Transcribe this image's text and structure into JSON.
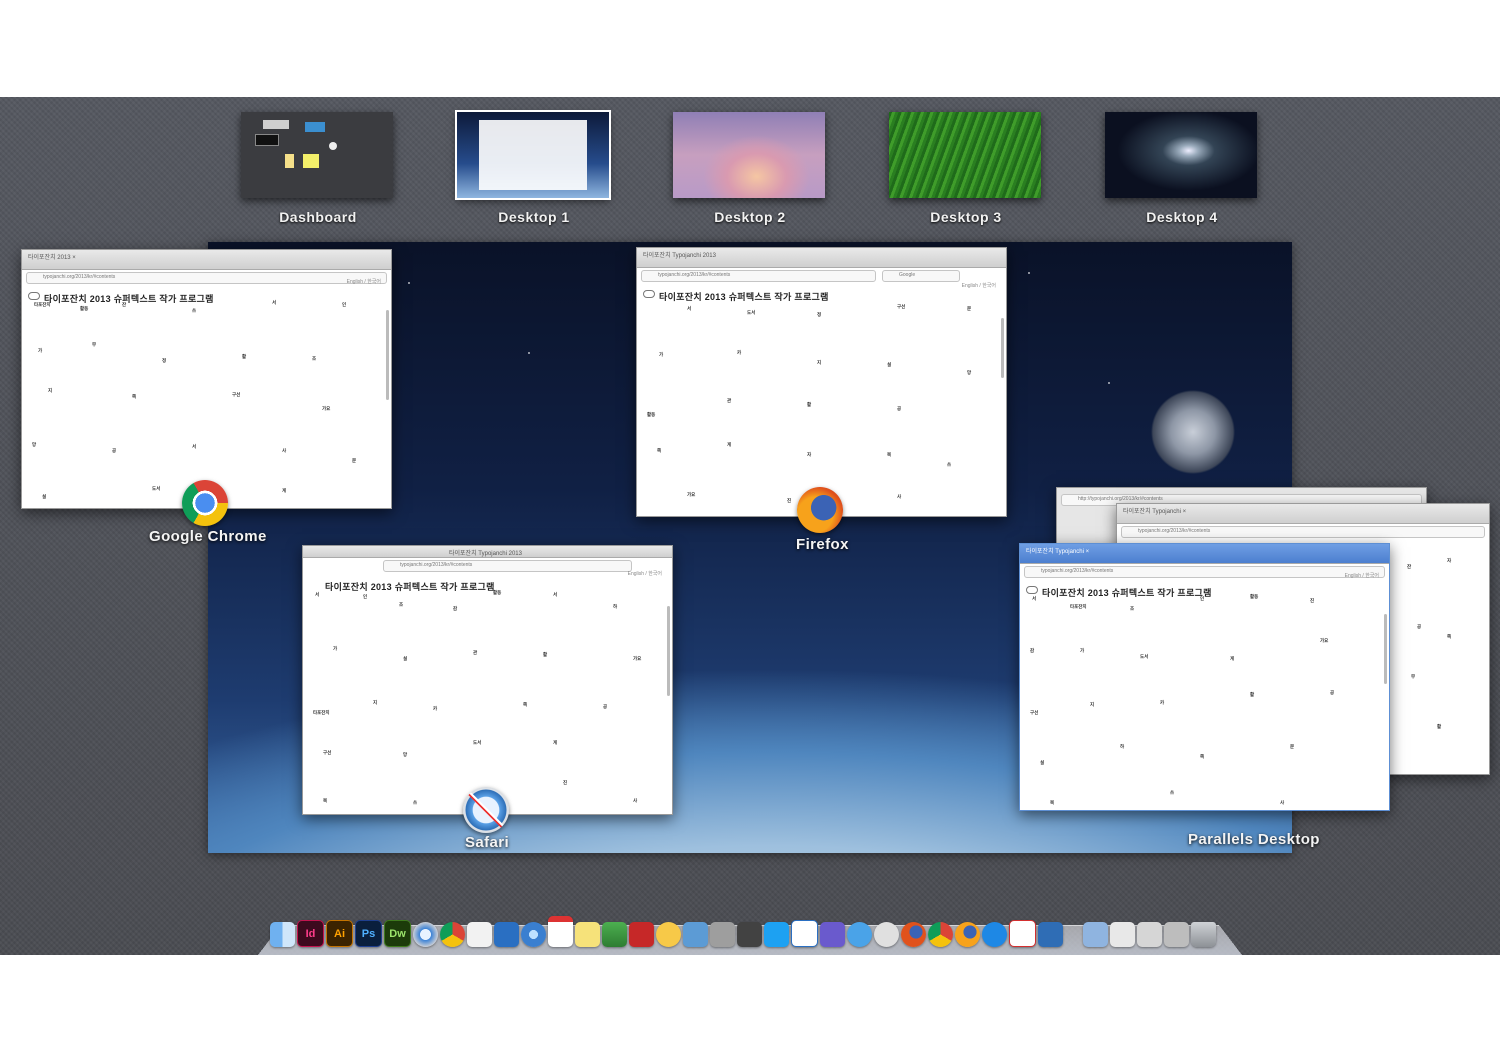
{
  "spaces": [
    {
      "label": "Dashboard"
    },
    {
      "label": "Desktop 1"
    },
    {
      "label": "Desktop 2"
    },
    {
      "label": "Desktop 3"
    },
    {
      "label": "Desktop 4"
    }
  ],
  "windows": {
    "site_title": "타이포잔치 2013   슈퍼텍스트   작가   프로그램",
    "lang": "English / 한국어",
    "chrome": {
      "app": "Google Chrome",
      "tab": "타이포잔치 2013 ×",
      "url": "typojanchi.org/2013/kr/#contents"
    },
    "firefox": {
      "app": "Firefox",
      "tab": "타이포잔치 Typojanchi 2013",
      "url": "typojanchi.org/2013/kr/#contents",
      "search": "Google"
    },
    "safari": {
      "app": "Safari",
      "tab": "타이포잔치 Typojanchi 2013",
      "url": "typojanchi.org/2013/kr/#contents"
    },
    "parallels": {
      "app": "Parallels Desktop",
      "tab": "타이포잔치 Typojanchi ×",
      "url": "typojanchi.org/2013/kr/#contents",
      "back_url": "http://typojanchi.org/2013/kr/#contents"
    }
  },
  "words": [
    "타포잔치",
    "활동",
    "잔",
    "쓰",
    "서",
    "인",
    "가",
    "무",
    "정",
    "활",
    "조",
    "지",
    "쪽",
    "구선",
    "가요",
    "망",
    "공",
    "서",
    "사",
    "문",
    "설",
    "도서",
    "게",
    "하",
    "카",
    "자",
    "진",
    "관",
    "감",
    "북"
  ],
  "dock": [
    {
      "icon": "finder-icon",
      "label": ""
    },
    {
      "icon": "indesign-icon",
      "label": "Id",
      "color": "#c3144f"
    },
    {
      "icon": "illustrator-icon",
      "label": "Ai",
      "color": "#c47300"
    },
    {
      "icon": "photoshop-icon",
      "label": "Ps",
      "color": "#1f3f8f"
    },
    {
      "icon": "dreamweaver-icon",
      "label": "Dw",
      "color": "#3f7b1e"
    }
  ],
  "colors": {
    "mc_bg": "#4e5056",
    "label_text": "#f2f2f2",
    "chrome_red": "#db4437",
    "firefox_orange": "#e0521c",
    "safari_blue": "#2e6fb8"
  }
}
